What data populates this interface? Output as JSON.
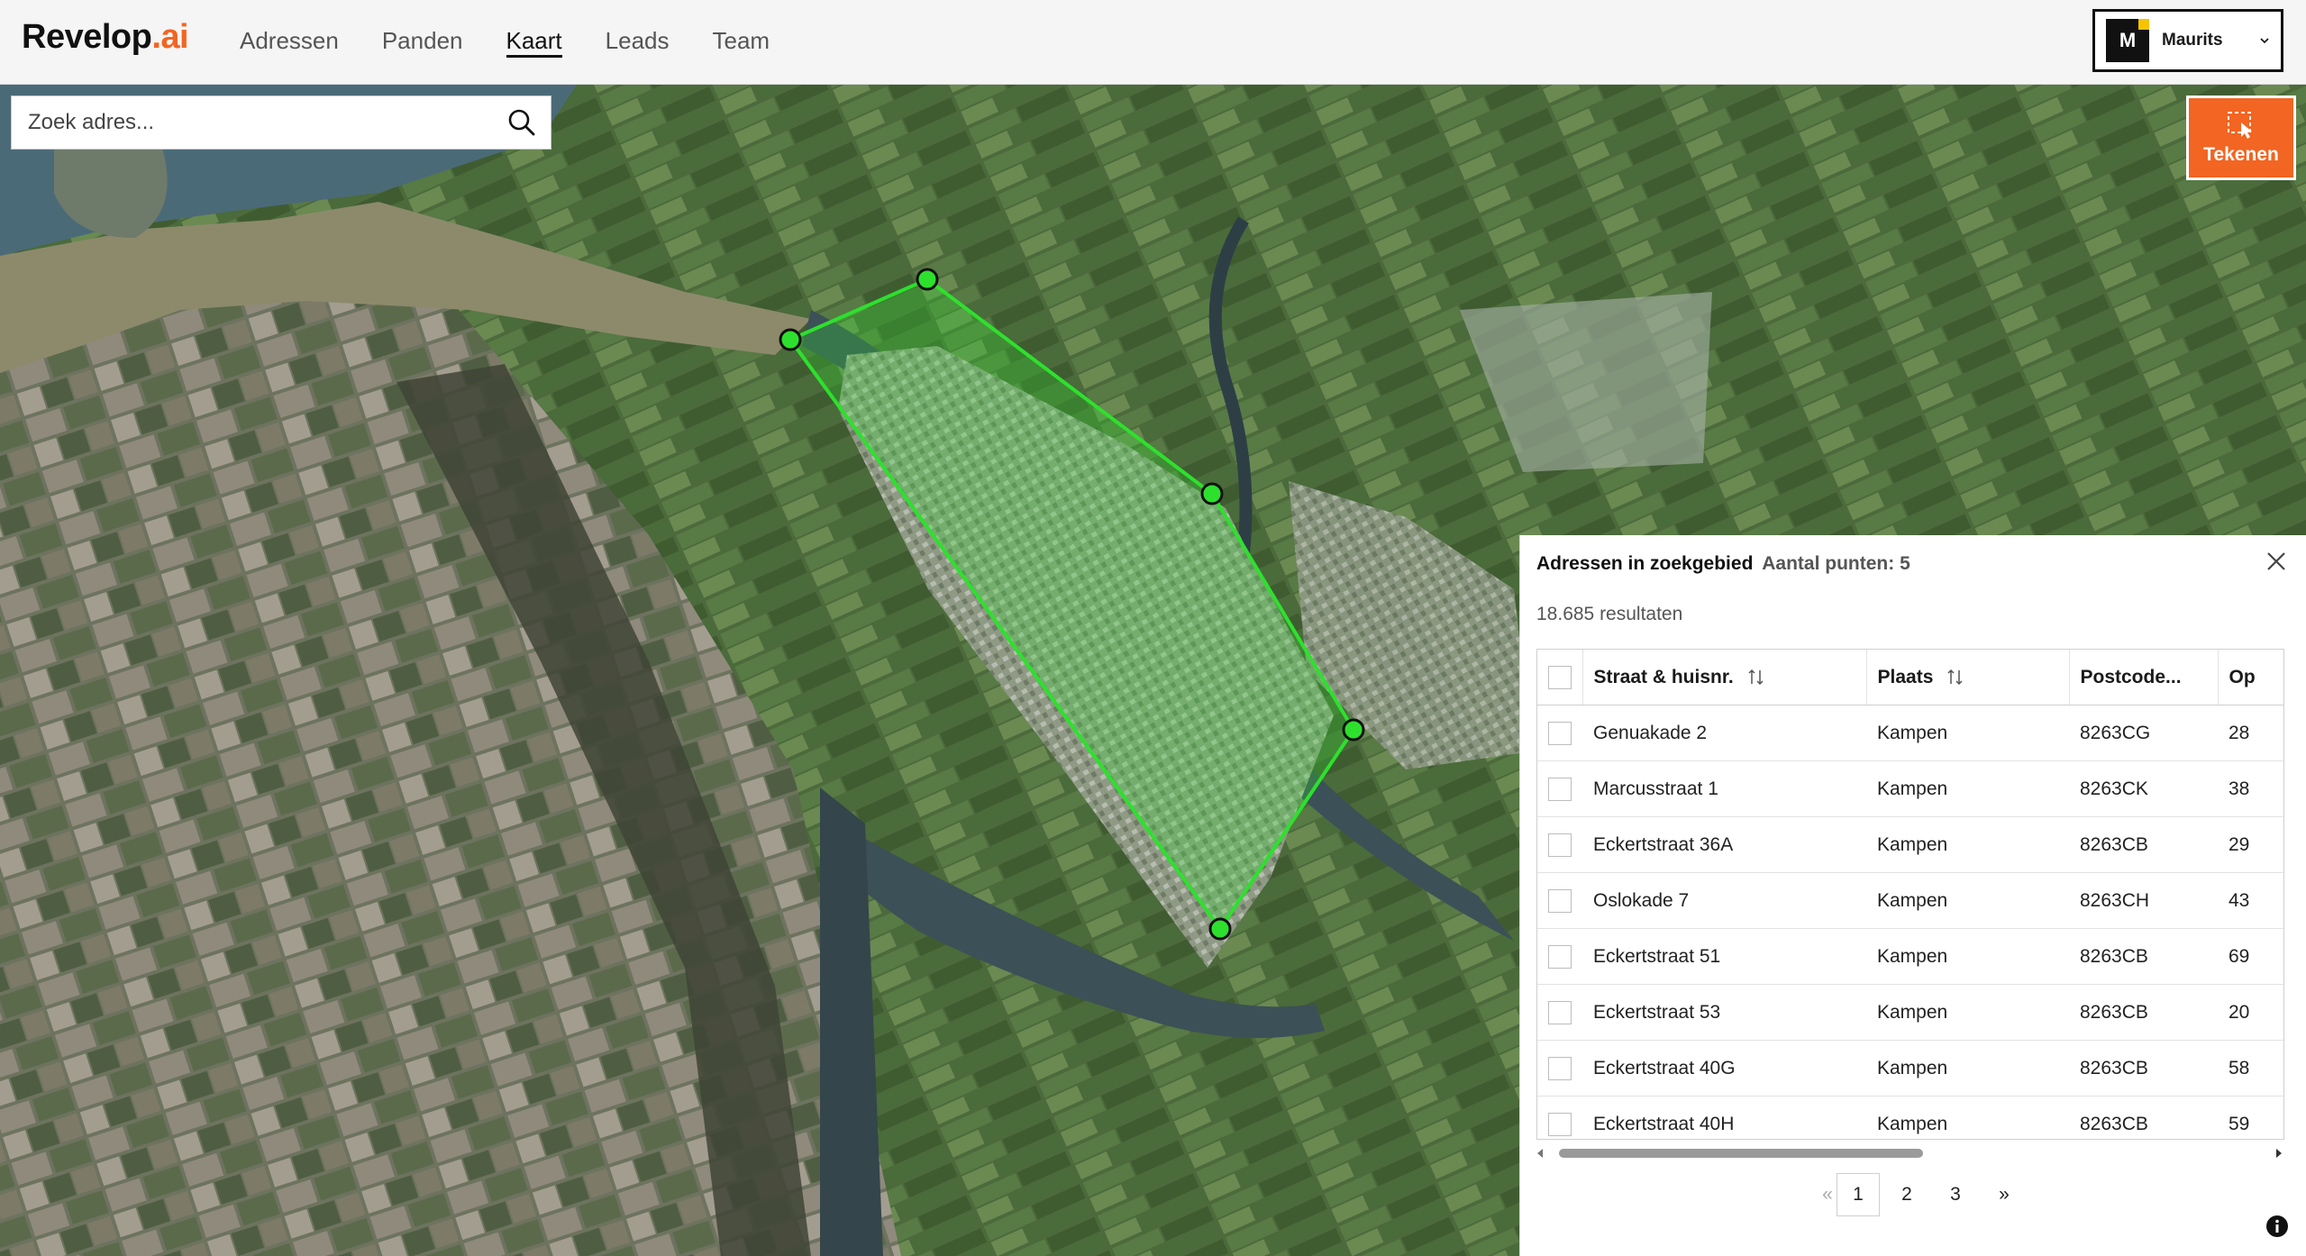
{
  "brand": {
    "name": "Revelop",
    "suffix": ".ai"
  },
  "nav": {
    "items": [
      {
        "label": "Adressen",
        "active": false
      },
      {
        "label": "Panden",
        "active": false
      },
      {
        "label": "Kaart",
        "active": true
      },
      {
        "label": "Leads",
        "active": false
      },
      {
        "label": "Team",
        "active": false
      }
    ]
  },
  "user": {
    "initial": "M",
    "name": "Maurits"
  },
  "search": {
    "placeholder": "Zoek adres..."
  },
  "draw_button": {
    "label": "Tekenen"
  },
  "panel": {
    "title": "Adressen in zoekgebied",
    "subtitle": "Aantal punten: 5",
    "results": "18.685 resultaten",
    "columns": [
      "Straat & huisnr.",
      "Plaats",
      "Postcode...",
      "Op"
    ],
    "rows": [
      {
        "street": "Genuakade 2",
        "city": "Kampen",
        "postcode": "8263CG",
        "extra": "28"
      },
      {
        "street": "Marcusstraat 1",
        "city": "Kampen",
        "postcode": "8263CK",
        "extra": "38"
      },
      {
        "street": "Eckertstraat 36A",
        "city": "Kampen",
        "postcode": "8263CB",
        "extra": "29"
      },
      {
        "street": "Oslokade 7",
        "city": "Kampen",
        "postcode": "8263CH",
        "extra": "43"
      },
      {
        "street": "Eckertstraat 51",
        "city": "Kampen",
        "postcode": "8263CB",
        "extra": "69"
      },
      {
        "street": "Eckertstraat 53",
        "city": "Kampen",
        "postcode": "8263CB",
        "extra": "20"
      },
      {
        "street": "Eckertstraat 40G",
        "city": "Kampen",
        "postcode": "8263CB",
        "extra": "58"
      },
      {
        "street": "Eckertstraat 40H",
        "city": "Kampen",
        "postcode": "8263CB",
        "extra": "59"
      }
    ]
  },
  "pagination": {
    "prev": "«",
    "pages": [
      "1",
      "2",
      "3"
    ],
    "current": "1",
    "next": "»"
  },
  "colors": {
    "accent": "#f26522",
    "polygon": "#2ee02e",
    "brand_dark": "#111111"
  },
  "icons": [
    "search-icon",
    "close-icon",
    "sort-icon",
    "draw-icon",
    "chevron-down-icon",
    "info-icon"
  ]
}
